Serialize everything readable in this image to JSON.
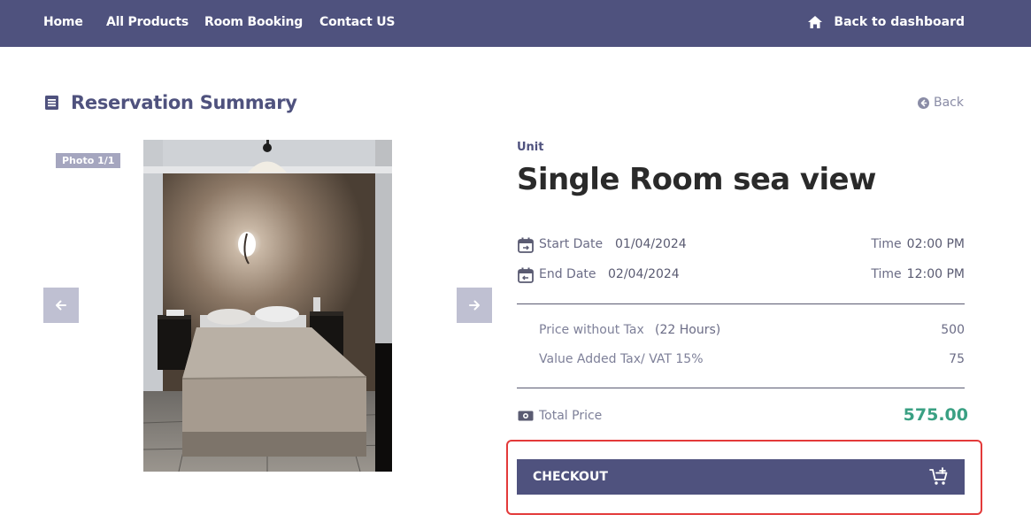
{
  "nav": {
    "home": "Home",
    "all_products": "All Products",
    "room_booking": "Room Booking",
    "contact": "Contact US",
    "dashboard": "Back to dashboard"
  },
  "summary": {
    "title": "Reservation Summary",
    "back": "Back"
  },
  "gallery": {
    "photo_counter": "Photo 1/1"
  },
  "details": {
    "unit_label": "Unit",
    "room_name": "Single Room sea view",
    "start": {
      "label": "Start Date",
      "date": "01/04/2024",
      "time_label": "Time",
      "time": "02:00 PM"
    },
    "end": {
      "label": "End Date",
      "date": "02/04/2024",
      "time_label": "Time",
      "time": "12:00 PM"
    },
    "price_without_tax": {
      "label": "Price without Tax",
      "duration": "(22 Hours)",
      "amount": "500"
    },
    "vat": {
      "label": "Value Added Tax/ VAT 15%",
      "amount": "75"
    },
    "total": {
      "label": "Total Price",
      "amount": "575.00"
    }
  },
  "checkout": {
    "label": "CHECKOUT"
  },
  "icons": [
    "home-icon",
    "list-icon",
    "back-circle-icon",
    "arrow-left-icon",
    "arrow-right-icon",
    "calendar-start-icon",
    "calendar-end-icon",
    "money-icon",
    "cart-icon"
  ],
  "colors": {
    "nav_bg": "#4f527e",
    "accent": "#4f527e",
    "total_price": "#3aa083",
    "highlight_border": "#e33a3a"
  }
}
